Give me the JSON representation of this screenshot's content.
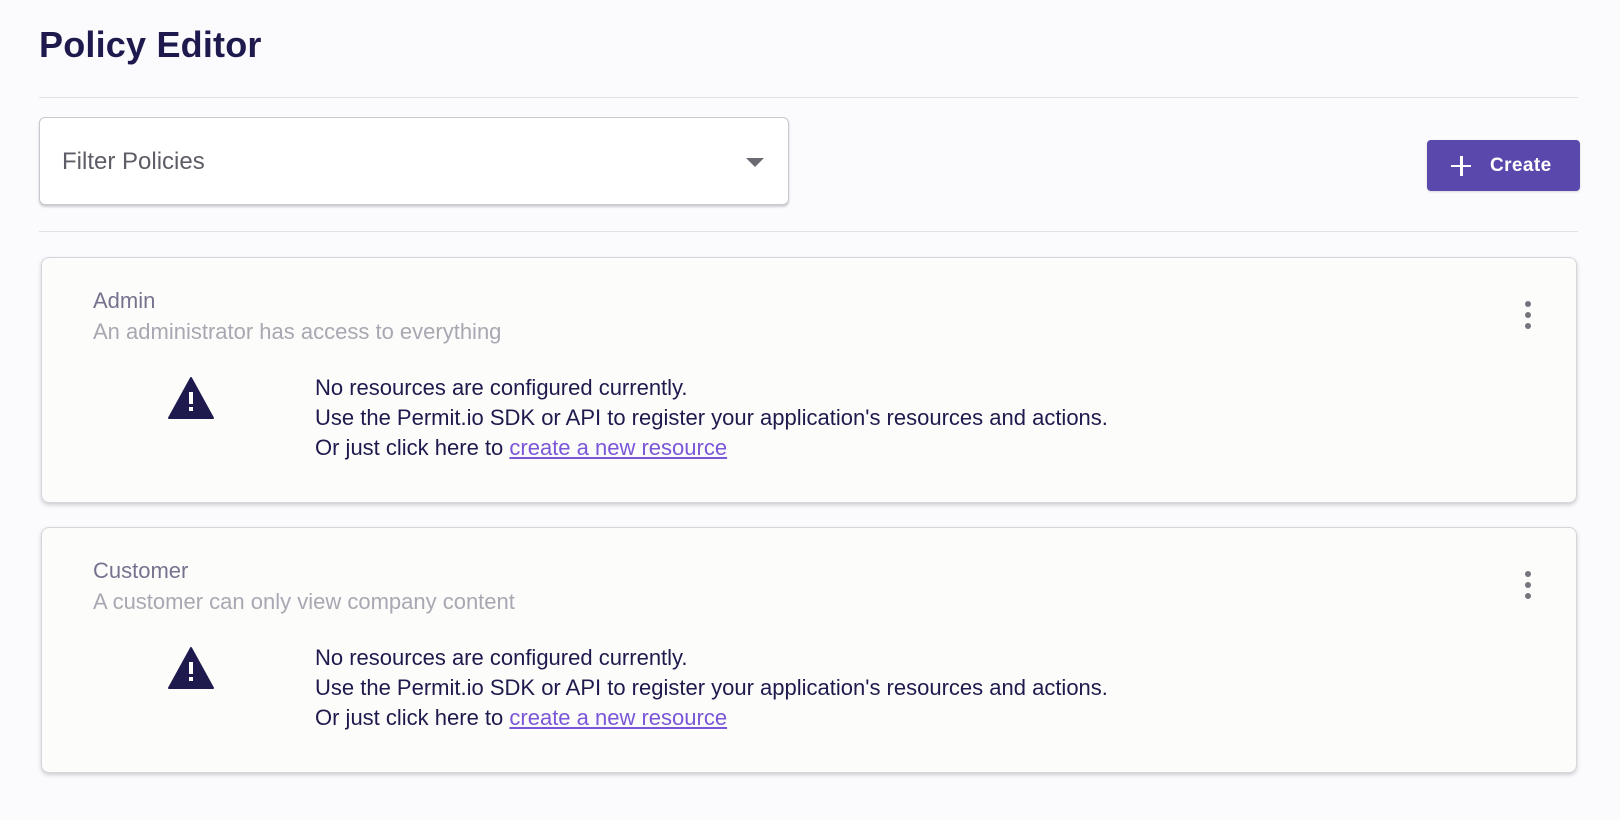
{
  "page": {
    "title": "Policy Editor"
  },
  "toolbar": {
    "filter_placeholder": "Filter Policies",
    "create_label": "Create",
    "create_color": "#5a48ad"
  },
  "policies": [
    {
      "name": "Admin",
      "description": "An administrator has access to everything",
      "message_line1": "No resources are configured currently.",
      "message_line2": "Use the Permit.io SDK or API to register your application's resources and actions.",
      "message_line3_prefix": "Or just click here to ",
      "link_text": "create a new resource"
    },
    {
      "name": "Customer",
      "description": "A customer can only view company content",
      "message_line1": "No resources are configured currently.",
      "message_line2": "Use the Permit.io SDK or API to register your application's resources and actions.",
      "message_line3_prefix": "Or just click here to ",
      "link_text": "create a new resource"
    }
  ],
  "icons": {
    "warning": "warning-icon",
    "more": "more-vertical-icon",
    "plus": "plus-icon",
    "caret": "chevron-down-icon"
  },
  "colors": {
    "accent": "#5a48ad",
    "link": "#7a56d8",
    "text_dark": "#1e1a4d",
    "background": "#fbfafd"
  }
}
